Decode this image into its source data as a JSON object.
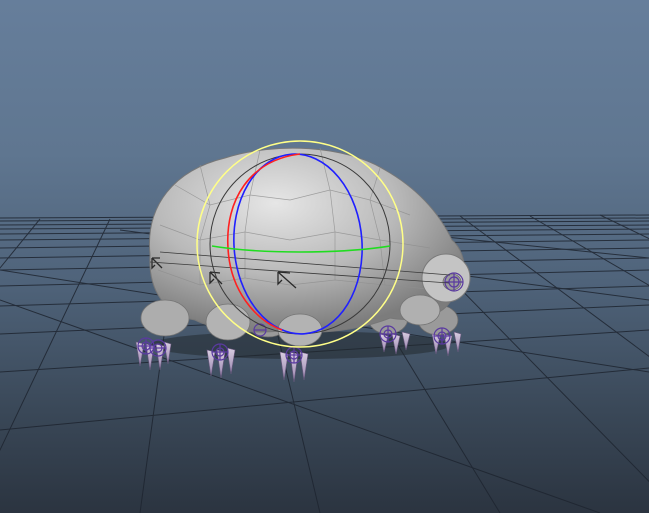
{
  "viewport": {
    "type": "3d-perspective",
    "colors": {
      "background_top": "#667e9b",
      "background_bottom": "#2b3440",
      "grid": "#1e2530",
      "mesh": "#b9b9b9",
      "rotate_x_ring": "#ff2020",
      "rotate_y_ring": "#20dd20",
      "rotate_z_ring": "#2020ff",
      "rotate_view_ring": "#ffff88",
      "joint_handles": "#5a3aa0"
    }
  },
  "scene": {
    "model": "tardigrade",
    "manipulator": "rotate-gizmo",
    "joint_handles_count": 8
  }
}
